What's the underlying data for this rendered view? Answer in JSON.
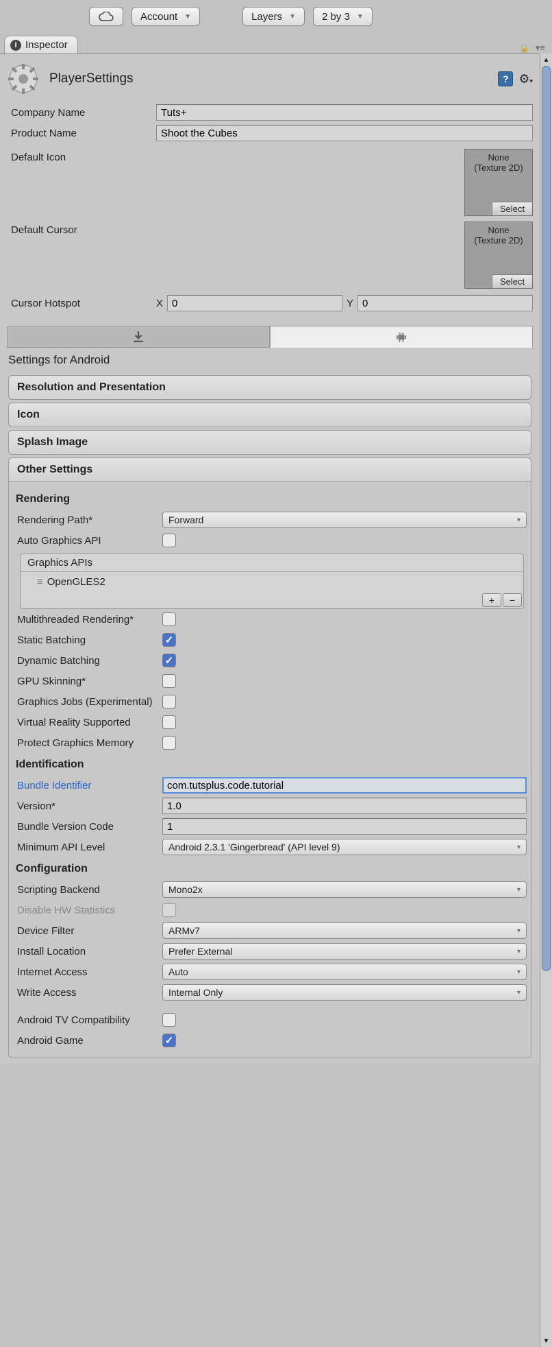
{
  "toolbar": {
    "account": "Account",
    "layers": "Layers",
    "layout": "2 by 3"
  },
  "tab": "Inspector",
  "header": {
    "title": "PlayerSettings"
  },
  "company": {
    "label": "Company Name",
    "value": "Tuts+"
  },
  "product": {
    "label": "Product Name",
    "value": "Shoot the Cubes"
  },
  "default_icon": {
    "label": "Default Icon",
    "none": "None",
    "type": "(Texture 2D)",
    "select": "Select"
  },
  "default_cursor": {
    "label": "Default Cursor",
    "none": "None",
    "type": "(Texture 2D)",
    "select": "Select"
  },
  "cursor_hotspot": {
    "label": "Cursor Hotspot",
    "x": "X",
    "y": "Y",
    "xv": "0",
    "yv": "0"
  },
  "settings_for": "Settings for Android",
  "foldouts": {
    "res": "Resolution and Presentation",
    "icon": "Icon",
    "splash": "Splash Image",
    "other": "Other Settings"
  },
  "rendering": {
    "title": "Rendering",
    "path_label": "Rendering Path*",
    "path_value": "Forward",
    "auto_api": "Auto Graphics API",
    "apis_header": "Graphics APIs",
    "api_item": "OpenGLES2",
    "multithreaded": "Multithreaded Rendering*",
    "static_batch": "Static Batching",
    "dynamic_batch": "Dynamic Batching",
    "gpu_skinning": "GPU Skinning*",
    "graphics_jobs": "Graphics Jobs (Experimental)",
    "vr": "Virtual Reality Supported",
    "protect_mem": "Protect Graphics Memory"
  },
  "identification": {
    "title": "Identification",
    "bundle_id_label": "Bundle Identifier",
    "bundle_id_value": "com.tutsplus.code.tutorial",
    "version_label": "Version*",
    "version_value": "1.0",
    "bvc_label": "Bundle Version Code",
    "bvc_value": "1",
    "min_api_label": "Minimum API Level",
    "min_api_value": "Android 2.3.1 'Gingerbread' (API level 9)"
  },
  "configuration": {
    "title": "Configuration",
    "scripting_label": "Scripting Backend",
    "scripting_value": "Mono2x",
    "disable_hw": "Disable HW Statistics",
    "device_filter_label": "Device Filter",
    "device_filter_value": "ARMv7",
    "install_loc_label": "Install Location",
    "install_loc_value": "Prefer External",
    "internet_label": "Internet Access",
    "internet_value": "Auto",
    "write_label": "Write Access",
    "write_value": "Internal Only",
    "tv_compat": "Android TV Compatibility",
    "android_game": "Android Game"
  }
}
